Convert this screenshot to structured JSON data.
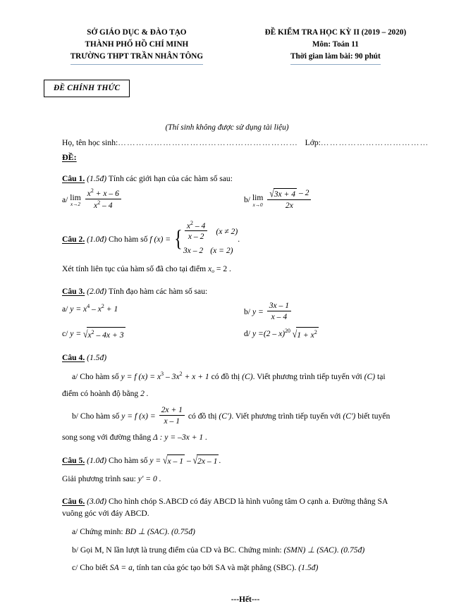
{
  "header": {
    "left": [
      "SỞ GIÁO DỤC & ĐÀO TẠO",
      "THÀNH PHỐ HỒ CHÍ MINH",
      "TRƯỜNG THPT TRẦN NHÂN TÔNG"
    ],
    "right": [
      "ĐỀ KIỂM TRA HỌC KỲ II (2019 – 2020)",
      "Môn: Toán 11",
      "Thời gian làm bài: 90 phút"
    ],
    "underline_color": "#8fa9c4"
  },
  "official_stamp": "ĐỀ CHÍNH THỨC",
  "notice": "(Thí sinh không được sử dụng tài liệu)",
  "student_info": {
    "name_label": "Họ, tên học sinh:",
    "class_label": "Lớp:",
    "dots": "……………………………………………………",
    "dots_class": "………………………………"
  },
  "de_label": "ĐỀ:",
  "questions": {
    "q1": {
      "title": "Câu 1.",
      "points": "(1.5đ)",
      "prompt": "Tính các giới hạn của các hàm số sau:",
      "a_label": "a/",
      "a_lim": "lim",
      "a_sub": "x→2",
      "a_num_1": "x",
      "a_num_exp": "2",
      "a_num_rest": "+ x – 6",
      "a_den_1": "x",
      "a_den_exp": "2",
      "a_den_rest": "– 4",
      "b_label": "b/",
      "b_lim": "lim",
      "b_sub": "x→0",
      "b_num_radicand": "3x + 4",
      "b_num_tail": "– 2",
      "b_den": "2x"
    },
    "q2": {
      "title": "Câu 2.",
      "points": "(1.0đ)",
      "prompt": "Cho hàm số",
      "fx": "f (x) =",
      "case1_num_var": "x",
      "case1_num_exp": "2",
      "case1_num_rest": "– 4",
      "case1_den": "x – 2",
      "case1_cond": "(x ≠ 2)",
      "case2_expr": "3x – 2",
      "case2_cond": "(x = 2)",
      "tail_dot": ".",
      "line2_a": "Xét tính liên tục của hàm số đã cho tại điểm",
      "line2_var": "x",
      "line2_sub": "o",
      "line2_val": "= 2 ."
    },
    "q3": {
      "title": "Câu 3.",
      "points": "(2.0đ)",
      "prompt": "Tính đạo hàm các hàm số sau:",
      "a": "a/  y = x⁴ – x² + 1",
      "a_label": "a/",
      "a_expr_y": "y = x",
      "a_exp1": "4",
      "a_mid": "– x",
      "a_exp2": "2",
      "a_tail": "+ 1",
      "b_label": "b/",
      "b_y": "y =",
      "b_num": "3x – 1",
      "b_den": "x – 4",
      "c_label": "c/",
      "c_y": "y =",
      "c_radicand_var": "x",
      "c_radicand_exp": "2",
      "c_radicand_rest": "– 4x + 3",
      "d_label": "d/",
      "d_y": "y =",
      "d_base": "(2 – x)",
      "d_exp": "20",
      "d_radicand": "1 + x",
      "d_radicand_exp": "2"
    },
    "q4": {
      "title": "Câu 4.",
      "points": "(1.5đ)",
      "a_p1": "a/ Cho hàm số",
      "a_fn": "y = f (x) = x",
      "a_exp1": "3",
      "a_mid": "– 3x",
      "a_exp2": "2",
      "a_tail": "+ x + 1",
      "a_p2": "có đồ thị",
      "a_c": "(C)",
      "a_p3": ". Viết  phương trình tiếp tuyến với",
      "a_c2": "(C)",
      "a_p4": "tại",
      "a_line2": "điểm có hoành độ bằng",
      "a_line2_val": "2 .",
      "b_p1": "b/ Cho hàm số",
      "b_fn": "y = f (x) =",
      "b_num": "2x + 1",
      "b_den": "x – 1",
      "b_p2": "có đồ thị",
      "b_c": "(C')",
      "b_p3": ". Viết  phương trình tiếp tuyến với",
      "b_c2": "(C')",
      "b_p4": "biết tuyến",
      "b_line2": "song song với đường thẳng",
      "b_delta": "Δ : y = –3x + 1 ."
    },
    "q5": {
      "title": "Câu 5.",
      "points": "(1.0đ)",
      "prompt": "Cho hàm số",
      "y_eq": "y =",
      "rad1": "x – 1",
      "minus": "–",
      "rad2": "2x – 1",
      "dot": ".",
      "line2_a": "Giải phương trình sau:",
      "line2_b": "y' = 0 ."
    },
    "q6": {
      "title": "Câu 6.",
      "points": "(3.0đ)",
      "prompt_l1": "Cho hình chóp S.ABCD có đáy ABCD là hình vuông tâm O cạnh a. Đường thẳng SA",
      "prompt_l2": "vuông góc với đáy ABCD.",
      "a_p1": "a/ Chứng minh:",
      "a_expr": "BD ⊥ (SAC)",
      "a_dot": ".",
      "a_pts": "(0.75đ)",
      "b_p1": "b/ Gọi M, N lần lượt là trung điểm của CD và BC. Chứng minh:",
      "b_expr": "(SMN) ⊥ (SAC)",
      "b_dot": ".",
      "b_pts": "(0.75đ)",
      "c_p1": "c/ Cho biết",
      "c_expr": "SA = a",
      "c_p2": ", tính tan của góc tạo bởi SA và mặt phẳng (SBC).",
      "c_pts": "(1.5đ)"
    }
  },
  "footer": "---Hết---"
}
